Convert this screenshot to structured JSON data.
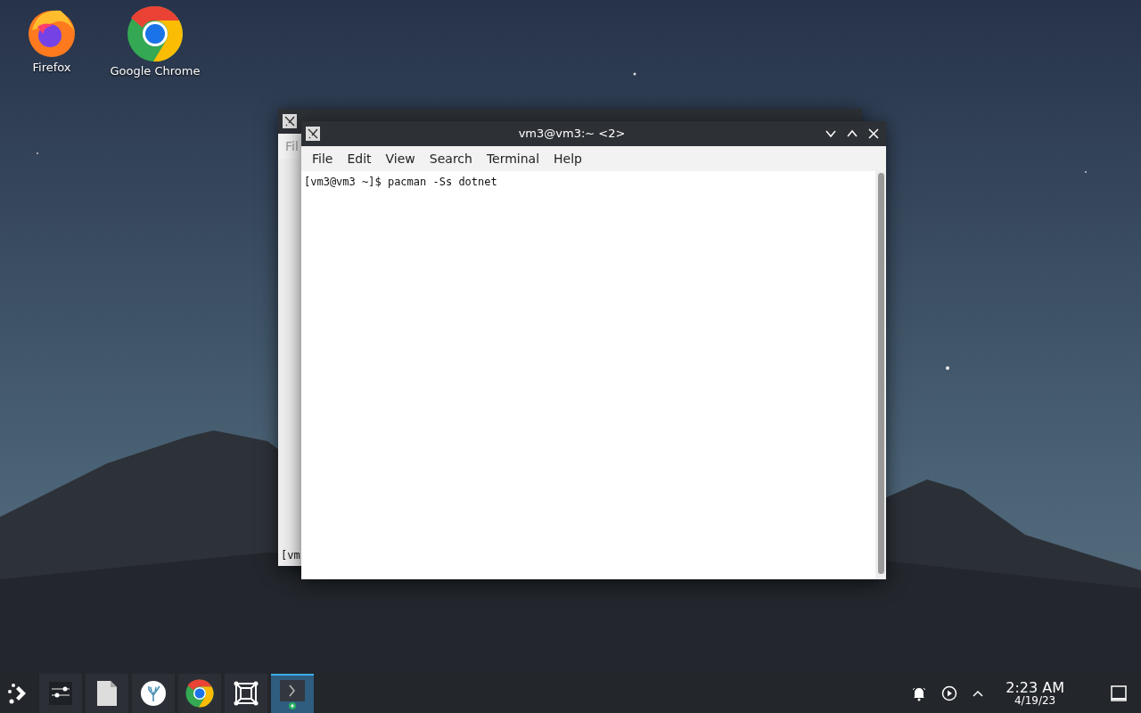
{
  "desktop_icons": [
    {
      "label": "Firefox",
      "kind": "firefox"
    },
    {
      "label": "Google Chrome",
      "kind": "chrome"
    }
  ],
  "back_window": {
    "menu_fragment": "Fil",
    "prompt_fragment": "[vm"
  },
  "window": {
    "title": "vm3@vm3:~ <2>",
    "menu": [
      "File",
      "Edit",
      "View",
      "Search",
      "Terminal",
      "Help"
    ],
    "lines": [
      "[vm3@vm3 ~]$ pacman -Ss dotnet"
    ]
  },
  "taskbar": {
    "items": [
      {
        "kind": "launcher",
        "selected": false
      },
      {
        "kind": "settings",
        "selected": false
      },
      {
        "kind": "file",
        "selected": false
      },
      {
        "kind": "coral",
        "selected": false
      },
      {
        "kind": "chrome",
        "selected": false
      },
      {
        "kind": "frame",
        "selected": false
      },
      {
        "kind": "terminal",
        "selected": true
      }
    ],
    "clock": {
      "time": "2:23 AM",
      "date": "4/19/23"
    }
  }
}
